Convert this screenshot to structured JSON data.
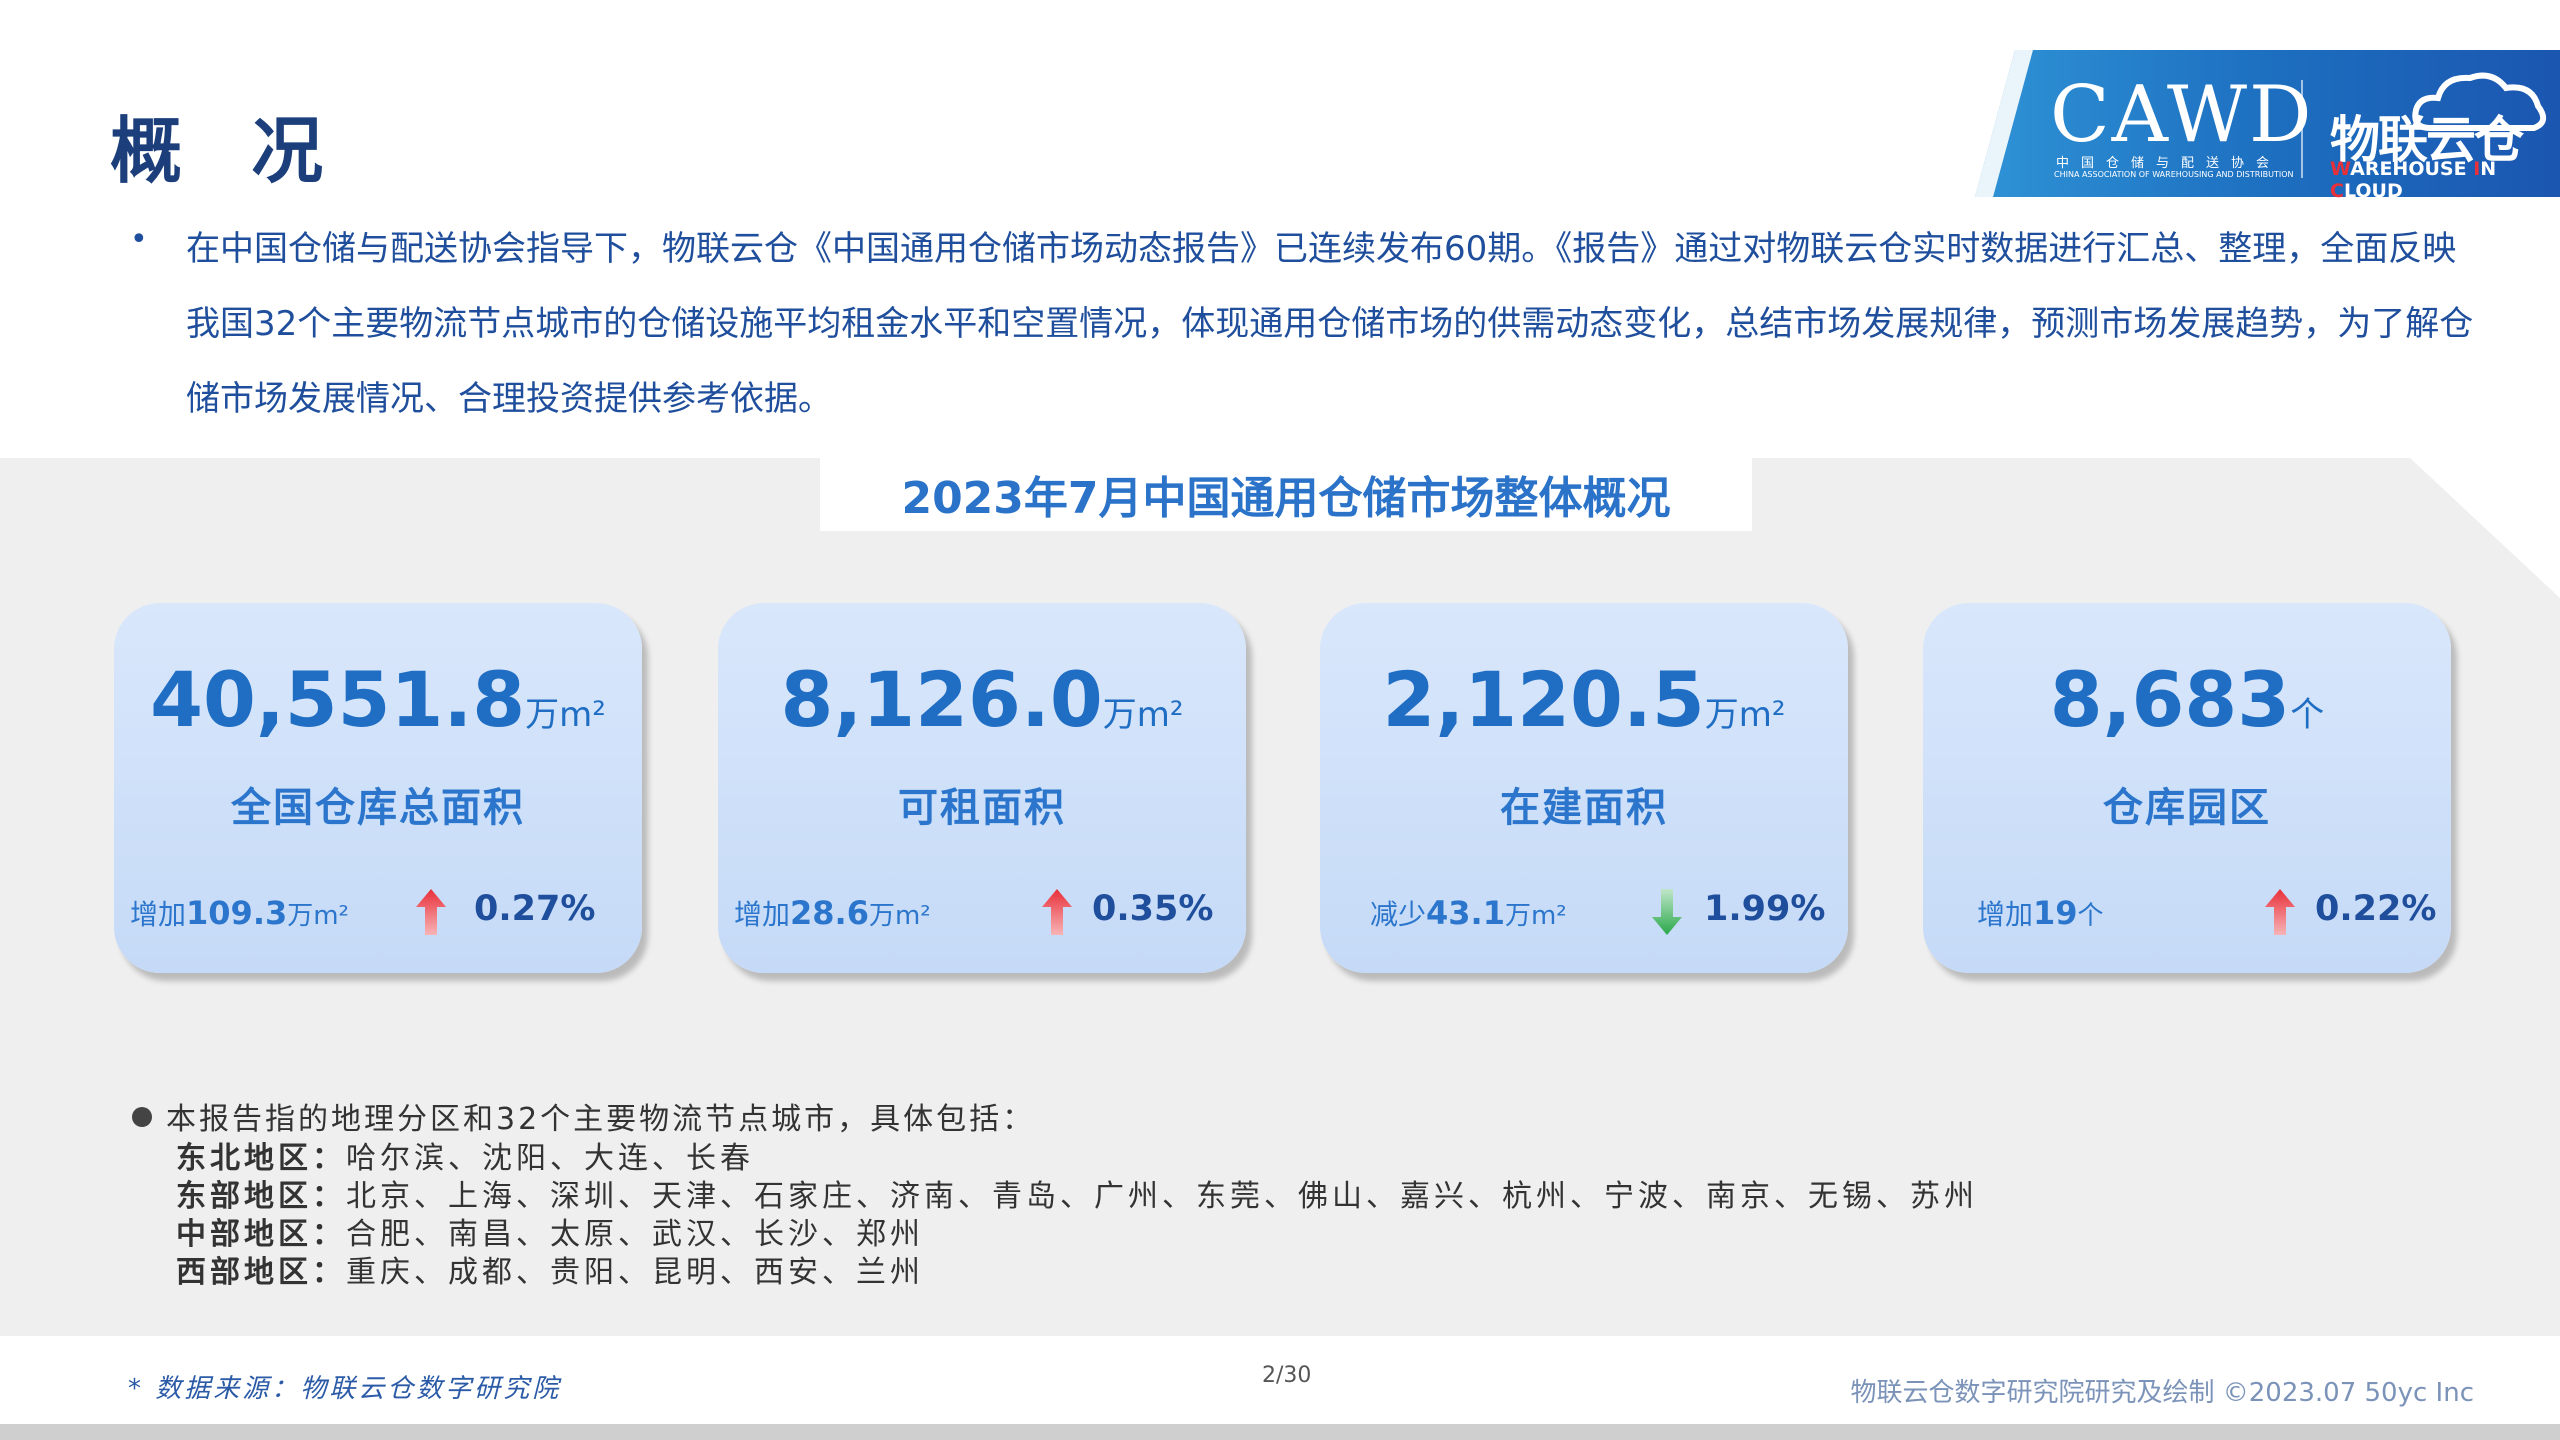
{
  "page_title": "概 况",
  "logo": {
    "cawd": "CAWD",
    "cawd_sub_cn": "中国仓储与配送协会",
    "cawd_sub_en": "CHINA ASSOCIATION OF WAREHOUSING AND DISTRIBUTION",
    "wic_cn": "物联云仓",
    "wic_en_w": "W",
    "wic_en_1": "AREHOUSE ",
    "wic_en_i": "I",
    "wic_en_2": "N ",
    "wic_en_c": "C",
    "wic_en_3": "LOUD"
  },
  "intro": {
    "bullet": "•",
    "text": "在中国仓储与配送协会指导下，物联云仓《中国通用仓储市场动态报告》已连续发布60期。《报告》通过对物联云仓实时数据进行汇总、整理，全面反映我国32个主要物流节点城市的仓储设施平均租金水平和空置情况，体现通用仓储市场的供需动态变化，总结市场发展规律，预测市场发展趋势，为了解仓储市场发展情况、合理投资提供参考依据。"
  },
  "section_title": "2023年7月中国通用仓储市场整体概况",
  "cards": [
    {
      "value": "40,551.8",
      "unit": "万m²",
      "label": "全国仓库总面积",
      "change_word": "增加",
      "change_num": "109.3",
      "change_unit": "万m²",
      "direction": "up",
      "pct": "0.27%"
    },
    {
      "value": "8,126.0",
      "unit": "万m²",
      "label": "可租面积",
      "change_word": "增加",
      "change_num": "28.6",
      "change_unit": "万m²",
      "direction": "up",
      "pct": "0.35%"
    },
    {
      "value": "2,120.5",
      "unit": "万m²",
      "label": "在建面积",
      "change_word": "减少",
      "change_num": "43.1",
      "change_unit": "万m²",
      "direction": "down",
      "pct": "1.99%"
    },
    {
      "value": "8,683",
      "unit": "个",
      "label": "仓库园区",
      "change_word": "增加",
      "change_num": "19",
      "change_unit": "个",
      "direction": "up",
      "pct": "0.22%"
    }
  ],
  "notes": {
    "intro": "本报告指的地理分区和32个主要物流节点城市，具体包括：",
    "regions": [
      {
        "name": "东北地区：",
        "cities": "哈尔滨、沈阳、大连、长春"
      },
      {
        "name": "东部地区：",
        "cities": "北京、上海、深圳、天津、石家庄、济南、青岛、广州、东莞、佛山、嘉兴、杭州、宁波、南京、无锡、苏州"
      },
      {
        "name": "中部地区：",
        "cities": "合肥、南昌、太原、武汉、长沙、郑州"
      },
      {
        "name": "西部地区：",
        "cities": "重庆、成都、贵阳、昆明、西安、兰州"
      }
    ]
  },
  "footer": {
    "source": "* 数据来源：物联云仓数字研究院",
    "page": "2/30",
    "right": "物联云仓数字研究院研究及绘制    ©2023.07 50yc Inc"
  },
  "colors": {
    "primary": "#1f6ec4",
    "up_arrow": "#e8303a",
    "down_arrow": "#2aa84a",
    "card_bg": "#cfe0f8"
  }
}
